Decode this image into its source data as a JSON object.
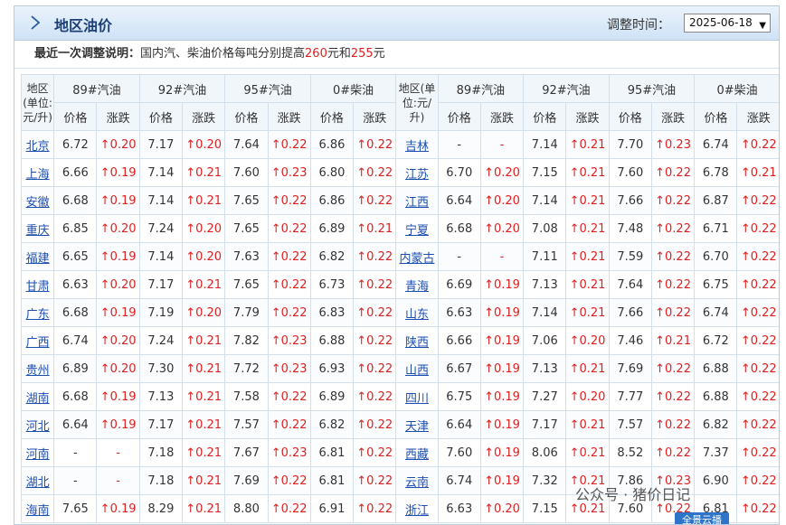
{
  "header": {
    "title": "地区油价",
    "adjust_label": "调整时间：",
    "date_selected": "2025-06-18"
  },
  "note": {
    "label": "最近一次调整说明：",
    "text_prefix": "国内汽、柴油价格每吨分别提高",
    "gasoline_raise": "260",
    "mid": "元和",
    "diesel_raise": "255",
    "suffix": "元"
  },
  "columns": {
    "region": "地区(单位:元/升)",
    "region_left": "地区\n(单位:\n元/升)",
    "region_right": "地区(单\n位:元/\n升)",
    "fuels": [
      "89#汽油",
      "92#汽油",
      "95#汽油",
      "0#柴油"
    ],
    "price": "价格",
    "change": "涨跌"
  },
  "rows": [
    {
      "l": [
        "北京",
        "6.72",
        "↑0.20",
        "7.17",
        "↑0.20",
        "7.64",
        "↑0.22",
        "6.86",
        "↑0.22"
      ],
      "r": [
        "吉林",
        "-",
        "-",
        "7.14",
        "↑0.21",
        "7.70",
        "↑0.23",
        "6.74",
        "↑0.22"
      ]
    },
    {
      "l": [
        "上海",
        "6.66",
        "↑0.19",
        "7.14",
        "↑0.21",
        "7.60",
        "↑0.23",
        "6.80",
        "↑0.22"
      ],
      "r": [
        "江苏",
        "6.70",
        "↑0.20",
        "7.15",
        "↑0.21",
        "7.60",
        "↑0.22",
        "6.78",
        "↑0.21"
      ]
    },
    {
      "l": [
        "安徽",
        "6.68",
        "↑0.19",
        "7.14",
        "↑0.21",
        "7.65",
        "↑0.22",
        "6.86",
        "↑0.22"
      ],
      "r": [
        "江西",
        "6.64",
        "↑0.20",
        "7.14",
        "↑0.21",
        "7.66",
        "↑0.22",
        "6.87",
        "↑0.22"
      ]
    },
    {
      "l": [
        "重庆",
        "6.85",
        "↑0.20",
        "7.24",
        "↑0.20",
        "7.65",
        "↑0.22",
        "6.89",
        "↑0.21"
      ],
      "r": [
        "宁夏",
        "6.68",
        "↑0.20",
        "7.08",
        "↑0.21",
        "7.48",
        "↑0.22",
        "6.71",
        "↑0.22"
      ]
    },
    {
      "l": [
        "福建",
        "6.65",
        "↑0.19",
        "7.14",
        "↑0.20",
        "7.63",
        "↑0.22",
        "6.82",
        "↑0.22"
      ],
      "r": [
        "内蒙古",
        "-",
        "-",
        "7.11",
        "↑0.21",
        "7.59",
        "↑0.22",
        "6.70",
        "↑0.22"
      ]
    },
    {
      "l": [
        "甘肃",
        "6.63",
        "↑0.20",
        "7.17",
        "↑0.21",
        "7.65",
        "↑0.22",
        "6.73",
        "↑0.22"
      ],
      "r": [
        "青海",
        "6.69",
        "↑0.19",
        "7.13",
        "↑0.21",
        "7.64",
        "↑0.22",
        "6.75",
        "↑0.22"
      ]
    },
    {
      "l": [
        "广东",
        "6.68",
        "↑0.19",
        "7.19",
        "↑0.20",
        "7.79",
        "↑0.22",
        "6.83",
        "↑0.22"
      ],
      "r": [
        "山东",
        "6.63",
        "↑0.19",
        "7.14",
        "↑0.21",
        "7.66",
        "↑0.22",
        "6.74",
        "↑0.22"
      ]
    },
    {
      "l": [
        "广西",
        "6.74",
        "↑0.20",
        "7.24",
        "↑0.21",
        "7.82",
        "↑0.23",
        "6.88",
        "↑0.22"
      ],
      "r": [
        "陕西",
        "6.66",
        "↑0.19",
        "7.06",
        "↑0.20",
        "7.46",
        "↑0.21",
        "6.72",
        "↑0.22"
      ]
    },
    {
      "l": [
        "贵州",
        "6.89",
        "↑0.20",
        "7.30",
        "↑0.21",
        "7.72",
        "↑0.23",
        "6.93",
        "↑0.22"
      ],
      "r": [
        "山西",
        "6.67",
        "↑0.19",
        "7.13",
        "↑0.21",
        "7.69",
        "↑0.22",
        "6.88",
        "↑0.22"
      ]
    },
    {
      "l": [
        "湖南",
        "6.68",
        "↑0.19",
        "7.13",
        "↑0.21",
        "7.58",
        "↑0.22",
        "6.89",
        "↑0.22"
      ],
      "r": [
        "四川",
        "6.75",
        "↑0.19",
        "7.27",
        "↑0.20",
        "7.77",
        "↑0.22",
        "6.88",
        "↑0.22"
      ]
    },
    {
      "l": [
        "河北",
        "6.64",
        "↑0.19",
        "7.17",
        "↑0.21",
        "7.57",
        "↑0.22",
        "6.82",
        "↑0.22"
      ],
      "r": [
        "天津",
        "6.64",
        "↑0.19",
        "7.17",
        "↑0.21",
        "7.57",
        "↑0.22",
        "6.82",
        "↑0.22"
      ]
    },
    {
      "l": [
        "河南",
        "-",
        "-",
        "7.18",
        "↑0.21",
        "7.67",
        "↑0.23",
        "6.81",
        "↑0.22"
      ],
      "r": [
        "西藏",
        "7.60",
        "↑0.19",
        "8.06",
        "↑0.21",
        "8.52",
        "↑0.22",
        "7.37",
        "↑0.22"
      ]
    },
    {
      "l": [
        "湖北",
        "-",
        "-",
        "7.18",
        "↑0.21",
        "7.69",
        "↑0.22",
        "6.81",
        "↑0.22"
      ],
      "r": [
        "云南",
        "6.74",
        "↑0.19",
        "7.32",
        "↑0.21",
        "7.86",
        "↑0.23",
        "6.90",
        "↑0.22"
      ]
    },
    {
      "l": [
        "海南",
        "7.65",
        "↑0.19",
        "8.29",
        "↑0.21",
        "8.80",
        "↑0.22",
        "6.91",
        "↑0.22"
      ],
      "r": [
        "浙江",
        "6.63",
        "↑0.20",
        "7.15",
        "↑0.21",
        "7.60",
        "↑0.22",
        "6.81",
        "↑0.22"
      ]
    }
  ],
  "watermark": {
    "text": "公众号 · 猪价日记",
    "badge": "全景云播"
  }
}
